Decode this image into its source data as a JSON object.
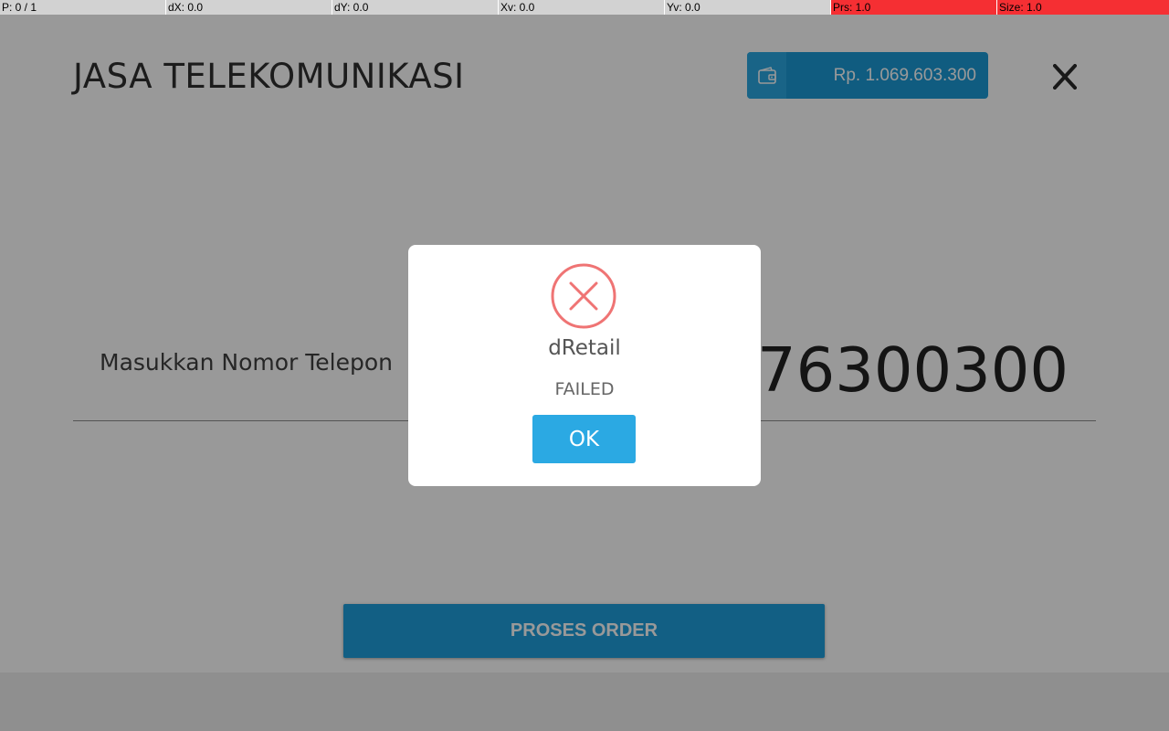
{
  "debug_bar": {
    "pointer": "P: 0 / 1",
    "dx": "dX: 0.0",
    "dy": "dY: 0.0",
    "xv": "Xv: 0.0",
    "yv": "Yv: 0.0",
    "prs": "Prs: 1.0",
    "size": "Size: 1.0",
    "alert_color": "#f52f33"
  },
  "header": {
    "title": "JASA TELEKOMUNIKASI",
    "wallet_icon": "wallet-icon",
    "balance": "Rp. 1.069.603.300",
    "close_icon": "close-icon"
  },
  "form": {
    "phone_label": "Masukkan Nomor Telepon",
    "phone_value": "081276300300"
  },
  "actions": {
    "proses_label": "PROSES ORDER"
  },
  "dialog": {
    "icon": "error-x-icon",
    "title": "dRetail",
    "message": "FAILED",
    "ok_label": "OK",
    "icon_color": "#ef7474"
  },
  "colors": {
    "accent": "#1f9fdd",
    "wallet_bg": "#1c9ad6",
    "dialog_button": "#2ba9e3"
  }
}
